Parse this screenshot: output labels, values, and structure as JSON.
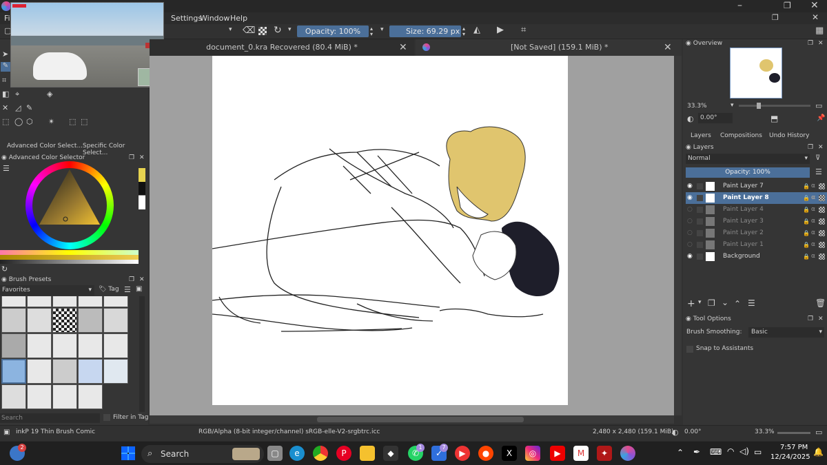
{
  "menubar": {
    "settings": "Settings",
    "window": "Window",
    "help": "Help",
    "file_partial": "Fi"
  },
  "toolbar": {
    "opacity_label": "Opacity: 100%",
    "size_label": "Size:",
    "size_value": "69.29 px"
  },
  "tabs": [
    {
      "title": "document_0.kra Recovered (80.4 MiB) *"
    },
    {
      "title": "[Not Saved]  (159.1 MiB) *"
    }
  ],
  "left": {
    "color_tabs": [
      "Advanced Color Select...",
      "Specific Color Select..."
    ],
    "color_selector_title": "Advanced Color Selector",
    "brush_presets_title": "Brush Presets",
    "favorites": "Favorites",
    "tag": "Tag",
    "search_placeholder": "Search",
    "filter_in_tag": "Filter in Tag"
  },
  "right": {
    "overview_title": "Overview",
    "zoom": "33.3%",
    "rotation": "0.00°",
    "dock_tabs": [
      "Layers",
      "Compositions",
      "Undo History"
    ],
    "layers_title": "Layers",
    "blend_mode": "Normal",
    "opacity": "Opacity:  100%",
    "layers": [
      {
        "name": "Paint Layer 7",
        "visible": true,
        "active": false
      },
      {
        "name": "Paint Layer 8",
        "visible": true,
        "active": true
      },
      {
        "name": "Paint Layer 4",
        "visible": false,
        "active": false
      },
      {
        "name": "Paint Layer 3",
        "visible": false,
        "active": false
      },
      {
        "name": "Paint Layer 2",
        "visible": false,
        "active": false
      },
      {
        "name": "Paint Layer 1",
        "visible": false,
        "active": false
      },
      {
        "name": "Background",
        "visible": true,
        "active": false
      }
    ],
    "tool_options_title": "Tool Options",
    "brush_smoothing_label": "Brush Smoothing:",
    "brush_smoothing_value": "Basic",
    "snap_label": "Snap to Assistants"
  },
  "status": {
    "brush": "inkP 19 Thin Brush Comic",
    "color_space": "RGB/Alpha (8-bit integer/channel)  sRGB-elle-V2-srgbtrc.icc",
    "dimensions": "2,480 x 2,480 (159.1 MiB)",
    "rotation": "0.00°",
    "zoom": "33.3%"
  },
  "taskbar": {
    "search": "Search",
    "time": "7:57 PM",
    "date": "12/24/2025",
    "badges": {
      "start": "2",
      "whatsapp": "1",
      "todo": "7"
    }
  },
  "colors": {
    "accent": "#4b6f99",
    "hair": "#e0c56e",
    "ink": "#1e1e2a"
  }
}
